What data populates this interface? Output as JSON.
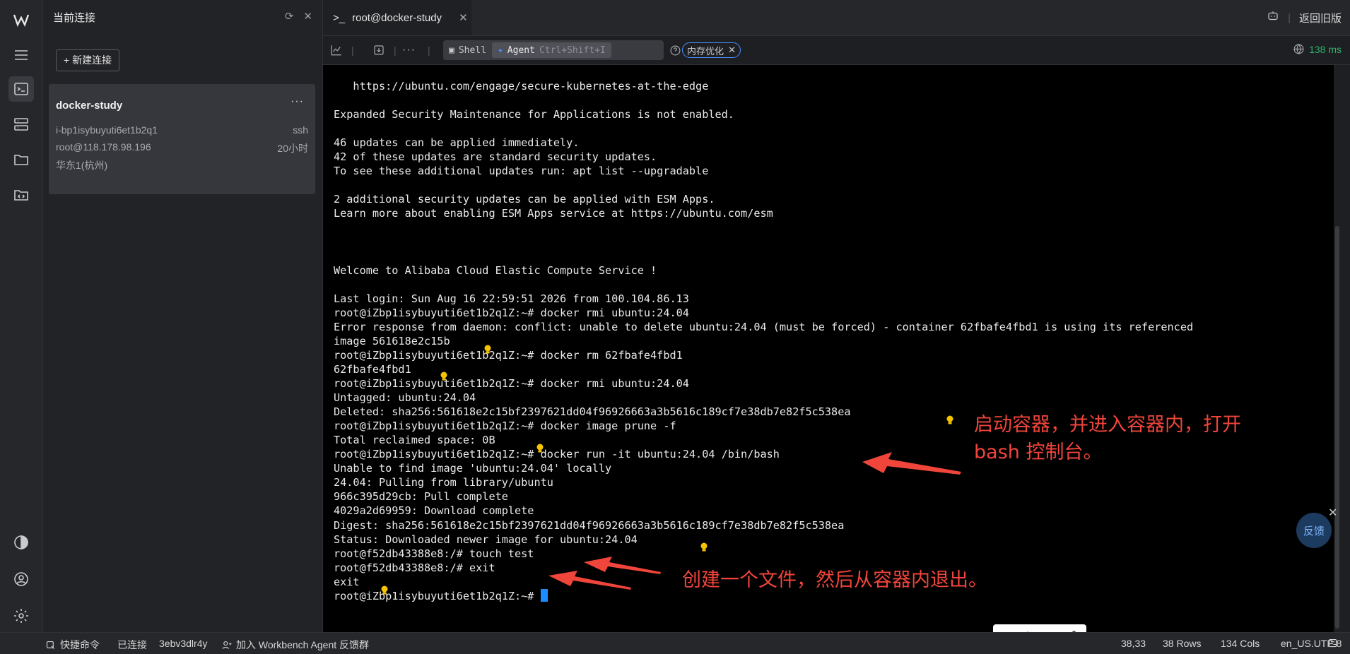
{
  "sidebar": {
    "title": "当前连接",
    "new_button": "+ 新建连接",
    "card": {
      "name": "docker-study",
      "instance_id": "i-bp1isybuyuti6et1b2q1",
      "protocol": "ssh",
      "address": "root@118.178.98.196",
      "age": "20小时",
      "region": "华东1(杭州)"
    }
  },
  "tab": {
    "title": "root@docker-study",
    "prompt_glyph": ">_"
  },
  "header_right": {
    "back_label": "返回旧版"
  },
  "toolbar": {
    "shell": "Shell",
    "agent": "Agent",
    "agent_shortcut": "Ctrl+Shift+I",
    "chip": "内存优化",
    "latency": "138 ms"
  },
  "terminal": {
    "lines": [
      "",
      "   https://ubuntu.com/engage/secure-kubernetes-at-the-edge",
      "",
      "Expanded Security Maintenance for Applications is not enabled.",
      "",
      "46 updates can be applied immediately.",
      "42 of these updates are standard security updates.",
      "To see these additional updates run: apt list --upgradable",
      "",
      "2 additional security updates can be applied with ESM Apps.",
      "Learn more about enabling ESM Apps service at https://ubuntu.com/esm",
      "",
      "",
      "",
      "Welcome to Alibaba Cloud Elastic Compute Service !",
      "",
      "Last login: Sun Aug 16 22:59:51 2026 from 100.104.86.13",
      "root@iZbp1isybuyuti6et1b2q1Z:~# docker rmi ubuntu:24.04",
      "Error response from daemon: conflict: unable to delete ubuntu:24.04 (must be forced) - container 62fbafe4fbd1 is using its referenced",
      "image 561618e2c15b",
      "root@iZbp1isybuyuti6et1b2q1Z:~# docker rm 62fbafe4fbd1",
      "62fbafe4fbd1",
      "root@iZbp1isybuyuti6et1b2q1Z:~# docker rmi ubuntu:24.04",
      "Untagged: ubuntu:24.04",
      "Deleted: sha256:561618e2c15bf2397621dd04f96926663a3b5616c189cf7e38db7e82f5c538ea",
      "root@iZbp1isybuyuti6et1b2q1Z:~# docker image prune -f",
      "Total reclaimed space: 0B",
      "root@iZbp1isybuyuti6et1b2q1Z:~# docker run -it ubuntu:24.04 /bin/bash",
      "Unable to find image 'ubuntu:24.04' locally",
      "24.04: Pulling from library/ubuntu",
      "966c395d29cb: Pull complete",
      "4029a2d69959: Download complete",
      "Digest: sha256:561618e2c15bf2397621dd04f96926663a3b5616c189cf7e38db7e82f5c538ea",
      "Status: Downloaded newer image for ubuntu:24.04",
      "root@f52db43388e8:/# touch test",
      "root@f52db43388e8:/# exit",
      "exit",
      "root@iZbp1isybuyuti6et1b2q1Z:~# "
    ]
  },
  "annotations": {
    "run_note_line1": "启动容器，并进入容器内，打开",
    "run_note_line2": "bash 控制台。",
    "exit_note": "创建一个文件，然后从容器内退出。",
    "color": "#f0453b"
  },
  "feedback": {
    "label": "反馈"
  },
  "statusbar": {
    "quick_cmd": "快捷命令",
    "connected": "已连接",
    "session": "3ebv3dlr4y",
    "join": "加入 Workbench Agent 反馈群",
    "position": "38,33",
    "rows": "38 Rows",
    "cols": "134 Cols",
    "encoding": "en_US.UTF-8"
  },
  "ime": {
    "mode": "中",
    "punct": "◦,"
  }
}
